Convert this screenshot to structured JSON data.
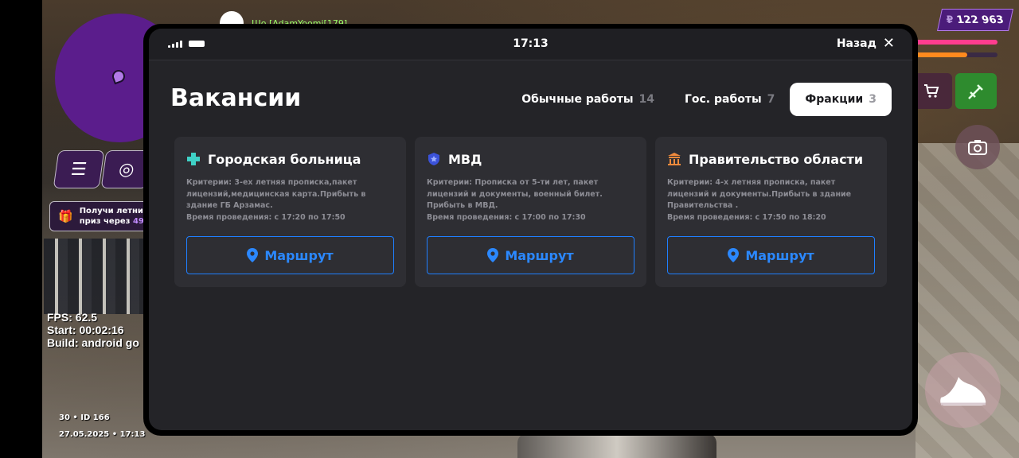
{
  "game_hud": {
    "gift_line1": "Получи летний",
    "gift_line2_prefix": "приз через ",
    "gift_number": "49",
    "fps_line": "FPS: 62.5",
    "start_line": "Start: 00:02:16",
    "build_line": "Build: android go",
    "player_id": "30 • ID 166",
    "datetime": "27.05.2025 • 17:13",
    "chat_line": "Шо [AdamYoomi[179]",
    "money_symbol": "₽",
    "money_value": "122 963",
    "armor_level": 0.66,
    "icons": [
      "menu-icon",
      "lifebuoy-icon",
      "gift-icon",
      "cart-icon",
      "weapon-icon",
      "camera-icon",
      "sneaker-icon"
    ]
  },
  "phone": {
    "time": "17:13",
    "back_label": "Назад",
    "page_title": "Вакансии",
    "tabs": [
      {
        "label": "Обычные работы",
        "count": "14",
        "active": false
      },
      {
        "label": "Гос. работы",
        "count": "7",
        "active": false
      },
      {
        "label": "Фракции",
        "count": "3",
        "active": true
      }
    ],
    "cards": [
      {
        "title": "Городская больница",
        "icon": "medical-cross-icon",
        "icon_color": "#3fd1c6",
        "criteria": "Критерии: 3-ех летняя прописка,пакет лицензий,медицинская карта.Прибыть в здание ГБ Арзамас.",
        "time": "Время проведения: с 17:20 по 17:50",
        "button": "Маршрут"
      },
      {
        "title": "МВД",
        "icon": "police-shield-icon",
        "icon_color": "#3b52d9",
        "criteria": "Критерии: Прописка от 5-ти лет, пакет лицензий и документы, военный билет. Прибыть в МВД.",
        "time": "Время проведения: с 17:00 по 17:30",
        "button": "Маршрут"
      },
      {
        "title": "Правительство области",
        "icon": "government-building-icon",
        "icon_color": "#f08a3c",
        "criteria": "Критерии: 4-х летняя прописка, пакет лицензий и документы.Прибыть в здание Правительства .",
        "time": "Время проведения: с 17:50 по 18:20",
        "button": "Маршрут"
      }
    ],
    "accent_color": "#2b88ff"
  }
}
